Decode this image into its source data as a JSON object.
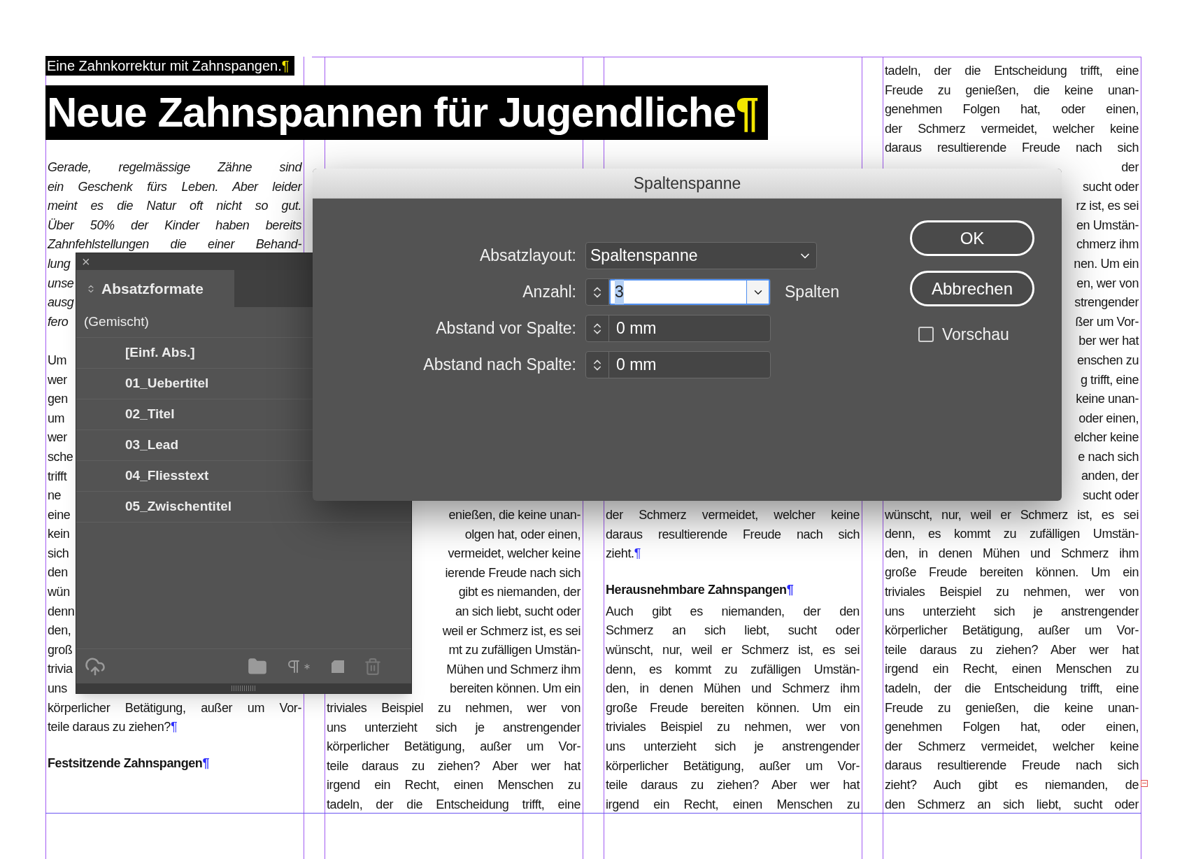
{
  "document": {
    "overtitle": {
      "text": "Eine Zahnkorrektur mit Zahnspangen.",
      "end": "¶"
    },
    "title": {
      "text": "Neue Zahnspannen für Jugendliche",
      "end": "¶"
    },
    "columns": [
      {
        "lines": [
          {
            "kind": "lead",
            "text": "Gerade, regelmässige Zähne sind"
          },
          {
            "kind": "lead",
            "text": "ein Geschenk fürs Leben. Aber leider"
          },
          {
            "kind": "lead",
            "text": "meint es die Natur oft nicht so gut."
          },
          {
            "kind": "lead",
            "text": "Über 50% der Kinder haben bereits"
          },
          {
            "kind": "lead",
            "text": "Zahnfehlstellungen die einer Behand-"
          },
          {
            "kind": "lead_left",
            "text": "lung"
          },
          {
            "kind": "lead_left",
            "text": "unse"
          },
          {
            "kind": "lead_left",
            "text": "ausg"
          },
          {
            "kind": "lead_left",
            "text": "fero"
          },
          {
            "kind": "left",
            "text": "Um"
          },
          {
            "kind": "left",
            "text": "wer"
          },
          {
            "kind": "left",
            "text": "gen"
          },
          {
            "kind": "left",
            "text": "um"
          },
          {
            "kind": "left",
            "text": "wer"
          },
          {
            "kind": "left",
            "text": "sche"
          },
          {
            "kind": "left",
            "text": "trifft"
          },
          {
            "kind": "left",
            "text": "ne"
          },
          {
            "kind": "left",
            "text": "eine"
          },
          {
            "kind": "left",
            "text": "kein"
          },
          {
            "kind": "left",
            "text": "sich"
          },
          {
            "kind": "left",
            "text": "den"
          },
          {
            "kind": "left",
            "text": "wün"
          },
          {
            "kind": "left",
            "text": "denn"
          },
          {
            "kind": "left",
            "text": "den,"
          },
          {
            "kind": "left",
            "text": "groß"
          },
          {
            "kind": "left",
            "text": "trivia"
          },
          {
            "kind": "left",
            "text": "uns"
          },
          {
            "kind": "full",
            "text": "körperlicher Betätigung, außer um Vor-"
          },
          {
            "kind": "last",
            "text": "teile daraus zu ziehen?",
            "end": "¶"
          },
          {
            "kind": "heading",
            "text": "Festsitzende Zahnspangen",
            "end": "¶"
          }
        ]
      },
      {
        "lines": [
          {
            "kind": "right",
            "text": "enießen, die keine unan-"
          },
          {
            "kind": "right",
            "text": "olgen hat, oder einen,"
          },
          {
            "kind": "right",
            "text": "vermeidet, welcher keine"
          },
          {
            "kind": "right",
            "text": "ierende Freude nach sich"
          },
          {
            "kind": "right",
            "text": "gibt es niemanden, der"
          },
          {
            "kind": "right",
            "text": "an sich liebt, sucht oder"
          },
          {
            "kind": "right",
            "text": "weil er Schmerz ist, es sei"
          },
          {
            "kind": "right",
            "text": "mt zu zufälligen Umstän-"
          },
          {
            "kind": "right",
            "text": "Mühen und Schmerz ihm"
          },
          {
            "kind": "right",
            "text": "bereiten können. Um ein"
          },
          {
            "kind": "full",
            "text": "triviales Beispiel zu nehmen, wer von"
          },
          {
            "kind": "full",
            "text": "uns unterzieht sich je anstrengender"
          },
          {
            "kind": "full",
            "text": "körperlicher Betätigung, außer um Vor-"
          },
          {
            "kind": "full",
            "text": "teile daraus zu ziehen? Aber wer hat"
          },
          {
            "kind": "full",
            "text": "irgend ein Recht, einen Menschen zu"
          },
          {
            "kind": "full",
            "text": "tadeln, der die Entscheidung trifft, eine"
          }
        ]
      },
      {
        "lines": [
          {
            "kind": "full",
            "text": "der Schmerz vermeidet, welcher keine"
          },
          {
            "kind": "full",
            "text": "daraus resultierende Freude nach sich"
          },
          {
            "kind": "last",
            "text": "zieht.",
            "end": "¶"
          },
          {
            "kind": "heading",
            "text": "Herausnehmbare Zahnspangen",
            "end": "¶"
          },
          {
            "kind": "full",
            "text": "Auch gibt es niemanden, der den"
          },
          {
            "kind": "full",
            "text": "Schmerz an sich liebt, sucht oder"
          },
          {
            "kind": "full",
            "text": "wünscht, nur, weil er Schmerz ist, es sei"
          },
          {
            "kind": "full",
            "text": "denn, es kommt zu zufälligen Umstän-"
          },
          {
            "kind": "full",
            "text": "den, in denen Mühen und Schmerz ihm"
          },
          {
            "kind": "full",
            "text": "große Freude bereiten können. Um ein"
          },
          {
            "kind": "full",
            "text": "triviales Beispiel zu nehmen, wer von"
          },
          {
            "kind": "full",
            "text": "uns unterzieht sich je anstrengender"
          },
          {
            "kind": "full",
            "text": "körperlicher Betätigung, außer um Vor-"
          },
          {
            "kind": "full",
            "text": "teile daraus zu ziehen? Aber wer hat"
          },
          {
            "kind": "full",
            "text": "irgend ein Recht, einen Menschen zu"
          }
        ]
      },
      {
        "lines": [
          {
            "kind": "full",
            "text": "tadeln, der die Entscheidung trifft, eine"
          },
          {
            "kind": "full",
            "text": "Freude zu genießen, die keine unan-"
          },
          {
            "kind": "full",
            "text": "genehmen Folgen hat, oder einen,"
          },
          {
            "kind": "full",
            "text": "der Schmerz vermeidet, welcher keine"
          },
          {
            "kind": "full",
            "text": "daraus resultierende Freude nach sich"
          },
          {
            "kind": "right",
            "text": "der"
          },
          {
            "kind": "right",
            "text": "sucht oder"
          },
          {
            "kind": "right",
            "text": "rz ist, es sei"
          },
          {
            "kind": "right",
            "text": "en Umstän-"
          },
          {
            "kind": "right",
            "text": "chmerz ihm"
          },
          {
            "kind": "right",
            "text": "nen. Um ein"
          },
          {
            "kind": "right",
            "text": "en, wer von"
          },
          {
            "kind": "right",
            "text": "strengender"
          },
          {
            "kind": "right",
            "text": "ßer um Vor-"
          },
          {
            "kind": "right",
            "text": "ber wer hat"
          },
          {
            "kind": "right",
            "text": "enschen zu"
          },
          {
            "kind": "right",
            "text": "g trifft, eine"
          },
          {
            "kind": "right",
            "text": "keine unan-"
          },
          {
            "kind": "right",
            "text": "oder einen,"
          },
          {
            "kind": "right",
            "text": "elcher keine"
          },
          {
            "kind": "right",
            "text": "e nach sich"
          },
          {
            "kind": "right",
            "text": "anden, der"
          },
          {
            "kind": "right",
            "text": "sucht oder"
          },
          {
            "kind": "full",
            "text": "wünscht, nur, weil er Schmerz ist, es sei"
          },
          {
            "kind": "full",
            "text": "denn, es kommt zu zufälligen Umstän-"
          },
          {
            "kind": "full",
            "text": "den, in denen Mühen und Schmerz ihm"
          },
          {
            "kind": "full",
            "text": "große Freude bereiten können. Um ein"
          },
          {
            "kind": "full",
            "text": "triviales Beispiel zu nehmen, wer von"
          },
          {
            "kind": "full",
            "text": "uns unterzieht sich je anstrengender"
          },
          {
            "kind": "full",
            "text": "körperlicher Betätigung, außer um Vor-"
          },
          {
            "kind": "full",
            "text": "teile daraus zu ziehen? Aber wer hat"
          },
          {
            "kind": "full",
            "text": "irgend ein Recht, einen Menschen zu"
          },
          {
            "kind": "full",
            "text": "tadeln, der die Entscheidung trifft, eine"
          },
          {
            "kind": "full",
            "text": "Freude zu genießen, die keine unan-"
          },
          {
            "kind": "full",
            "text": "genehmen Folgen hat, oder einen,"
          },
          {
            "kind": "full",
            "text": "der Schmerz vermeidet, welcher keine"
          },
          {
            "kind": "full",
            "text": "daraus resultierende Freude nach sich"
          },
          {
            "kind": "full",
            "text": "zieht? Auch gibt es niemanden, de",
            "overset": true
          },
          {
            "kind": "full",
            "text": "den Schmerz an sich liebt, sucht oder"
          }
        ]
      }
    ]
  },
  "panel": {
    "close": "×",
    "tab": {
      "label": "Absatzformate",
      "selected": true
    },
    "items": [
      {
        "kind": "group",
        "label": "(Gemischt)"
      },
      {
        "kind": "style",
        "label": "[Einf. Abs.]"
      },
      {
        "kind": "style",
        "label": "01_Uebertitel"
      },
      {
        "kind": "style",
        "label": "02_Titel"
      },
      {
        "kind": "style",
        "label": "03_Lead"
      },
      {
        "kind": "style",
        "label": "04_Fliesstext"
      },
      {
        "kind": "style",
        "label": "05_Zwischentitel"
      }
    ]
  },
  "dialog": {
    "title": "Spaltenspanne",
    "fields": [
      {
        "kind": "select",
        "label": "Absatzlayout:",
        "value": "Spaltenspanne"
      },
      {
        "kind": "combo",
        "label": "Anzahl:",
        "value": "3",
        "text_selected": true,
        "suffix": "Spalten"
      },
      {
        "kind": "spinner",
        "label": "Abstand vor Spalte:",
        "value": "0 mm"
      },
      {
        "kind": "spinner",
        "label": "Abstand nach Spalte:",
        "value": "0 mm"
      }
    ],
    "buttons": [
      "OK",
      "Abbrechen"
    ],
    "preview": {
      "label": "Vorschau",
      "checked": false
    }
  }
}
